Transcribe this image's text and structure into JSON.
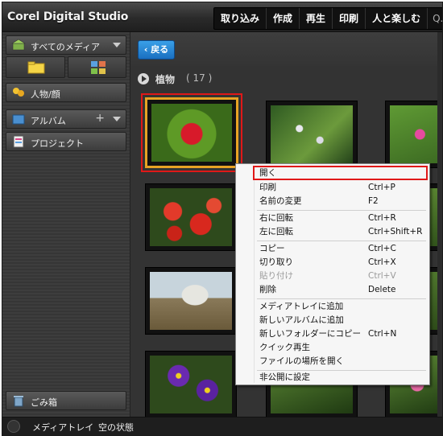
{
  "window": {
    "title": "Corel Digital Studio"
  },
  "menu": [
    {
      "label": "取り込み"
    },
    {
      "label": "作成"
    },
    {
      "label": "再生"
    },
    {
      "label": "印刷"
    },
    {
      "label": "人と楽しむ"
    },
    {
      "label": "Q.."
    }
  ],
  "sidebar": {
    "all_media": "すべてのメディア",
    "people": "人物/顔",
    "album": "アルバム",
    "project": "プロジェクト",
    "trash": "ごみ箱"
  },
  "content": {
    "back_label": "戻る",
    "group_name": "植物",
    "group_count": "( 17 )"
  },
  "tray": {
    "label": "メディアトレイ",
    "status": "空の状態"
  },
  "context_menu": {
    "items": [
      {
        "label": "開く",
        "shortcut": ""
      },
      {
        "label": "印刷",
        "shortcut": "Ctrl+P"
      },
      {
        "label": "名前の変更",
        "shortcut": "F2"
      },
      {
        "label": "右に回転",
        "shortcut": "Ctrl+R"
      },
      {
        "label": "左に回転",
        "shortcut": "Ctrl+Shift+R"
      },
      {
        "label": "コピー",
        "shortcut": "Ctrl+C"
      },
      {
        "label": "切り取り",
        "shortcut": "Ctrl+X"
      },
      {
        "label": "貼り付け",
        "shortcut": "Ctrl+V",
        "disabled": true
      },
      {
        "label": "削除",
        "shortcut": "Delete"
      },
      {
        "label": "メディアトレイに追加",
        "shortcut": ""
      },
      {
        "label": "新しいアルバムに追加",
        "shortcut": ""
      },
      {
        "label": "新しいフォルダーにコピー",
        "shortcut": "Ctrl+N"
      },
      {
        "label": "クイック再生",
        "shortcut": ""
      },
      {
        "label": "ファイルの場所を開く",
        "shortcut": ""
      },
      {
        "label": "非公開に設定",
        "shortcut": ""
      }
    ]
  },
  "colors": {
    "selection": "#e7a324",
    "highlight_box": "#e01818",
    "back_button": "#2a8ad8"
  }
}
